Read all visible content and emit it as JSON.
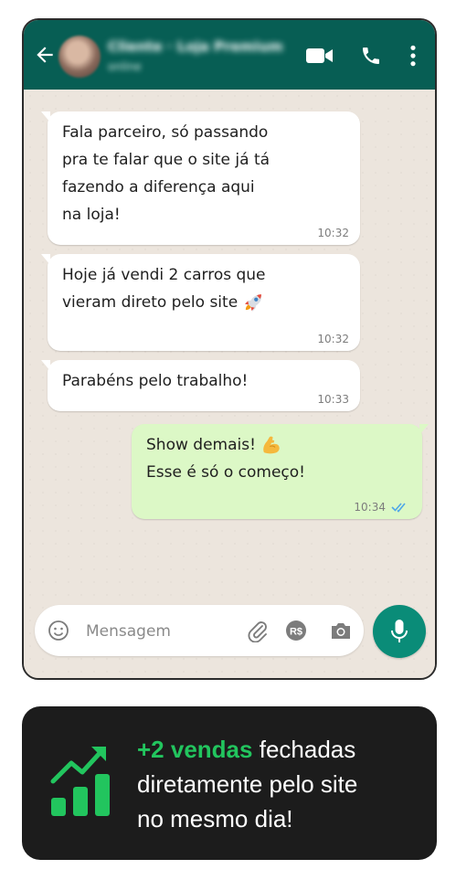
{
  "header": {
    "contact_name": "Cliente · Loja Premium",
    "contact_status": "online",
    "icons": [
      "back-arrow-icon",
      "video-call-icon",
      "phone-call-icon",
      "menu-dots-icon"
    ]
  },
  "messages": [
    {
      "direction": "in",
      "text": "Fala parceiro, só passando\npra te falar que o site já tá\nfazendo a diferença aqui\nna loja!",
      "time": "10:32"
    },
    {
      "direction": "in",
      "text": "Hoje já vendi 2 carros que\nvieram direto pelo site",
      "emoji": "rocket-emoji",
      "time": "10:32"
    },
    {
      "direction": "in",
      "text": "Parabéns pelo trabalho!",
      "time": "10:33"
    },
    {
      "direction": "out",
      "line1": "Show demais!",
      "emoji": "flexed-biceps-emoji",
      "line2": "Esse é só o começo!",
      "time": "10:34",
      "status": "read-double-check"
    }
  ],
  "input_bar": {
    "placeholder": "Mensagem",
    "icons": [
      "emoji-icon",
      "attach-clip-icon",
      "payment-icon",
      "camera-icon",
      "microphone-icon"
    ]
  },
  "banner": {
    "highlight": "+2 vendas",
    "text_line1_rest": "fechadas",
    "text_line2": "diretamente pelo site",
    "text_line3": "no mesmo dia!",
    "icon": "growth-chart-icon"
  },
  "colors": {
    "header_green": "#075e54",
    "outgoing_bubble": "#dcf8c6",
    "mic_button": "#0a8c78",
    "read_check_blue": "#4fa7e8",
    "banner_bg": "#1c1c1c",
    "banner_accent": "#22c55e"
  }
}
